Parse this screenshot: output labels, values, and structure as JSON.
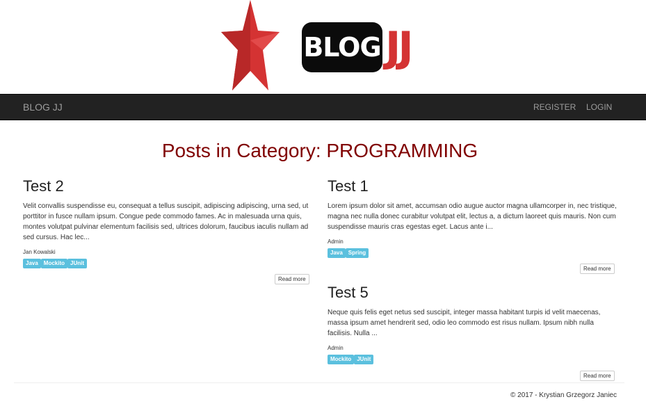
{
  "logo": {
    "blog_text": "BLOG",
    "jj_text": "JJ",
    "colors": {
      "star": "#d43333",
      "box": "#0b0b0b",
      "jj": "#d43333"
    }
  },
  "navbar": {
    "brand": "BLOG JJ",
    "links": [
      {
        "label": "REGISTER"
      },
      {
        "label": "LOGIN"
      }
    ]
  },
  "page": {
    "title": "Posts in Category: PROGRAMMING",
    "title_color": "#800000"
  },
  "posts": [
    {
      "title": "Test 2",
      "excerpt": "Velit convallis suspendisse eu, consequat a tellus suscipit, adipiscing adipiscing, urna sed, ut porttitor in fusce nullam ipsum. Congue pede commodo fames. Ac in malesuada urna quis, montes volutpat pulvinar elementum facilisis sed, ultrices dolorum, faucibus iaculis nullam ad sed cursus. Hac lec...",
      "author": "Jan Kowalski",
      "tags": [
        "Java",
        "Mockito",
        "JUnit"
      ],
      "read_more": "Read more"
    },
    {
      "title": "Test 1",
      "excerpt": "Lorem ipsum dolor sit amet, accumsan odio augue auctor magna ullamcorper in, nec tristique, magna nec nulla donec curabitur volutpat elit, lectus a, a dictum laoreet quis mauris. Non cum suspendisse mauris cras egestas eget. Lacus ante i...",
      "author": "Admin",
      "tags": [
        "Java",
        "Spring"
      ],
      "read_more": "Read more"
    },
    {
      "title": "Test 5",
      "excerpt": "Neque quis felis eget netus sed suscipit, integer massa habitant turpis id velit maecenas, massa ipsum amet hendrerit sed, odio leo commodo est risus nullam. Ipsum nibh nulla facilisis. Nulla ...",
      "author": "Admin",
      "tags": [
        "Mockito",
        "JUnit"
      ],
      "read_more": "Read more"
    }
  ],
  "footer": {
    "text": "© 2017 - Krystian Grzegorz Janiec"
  }
}
